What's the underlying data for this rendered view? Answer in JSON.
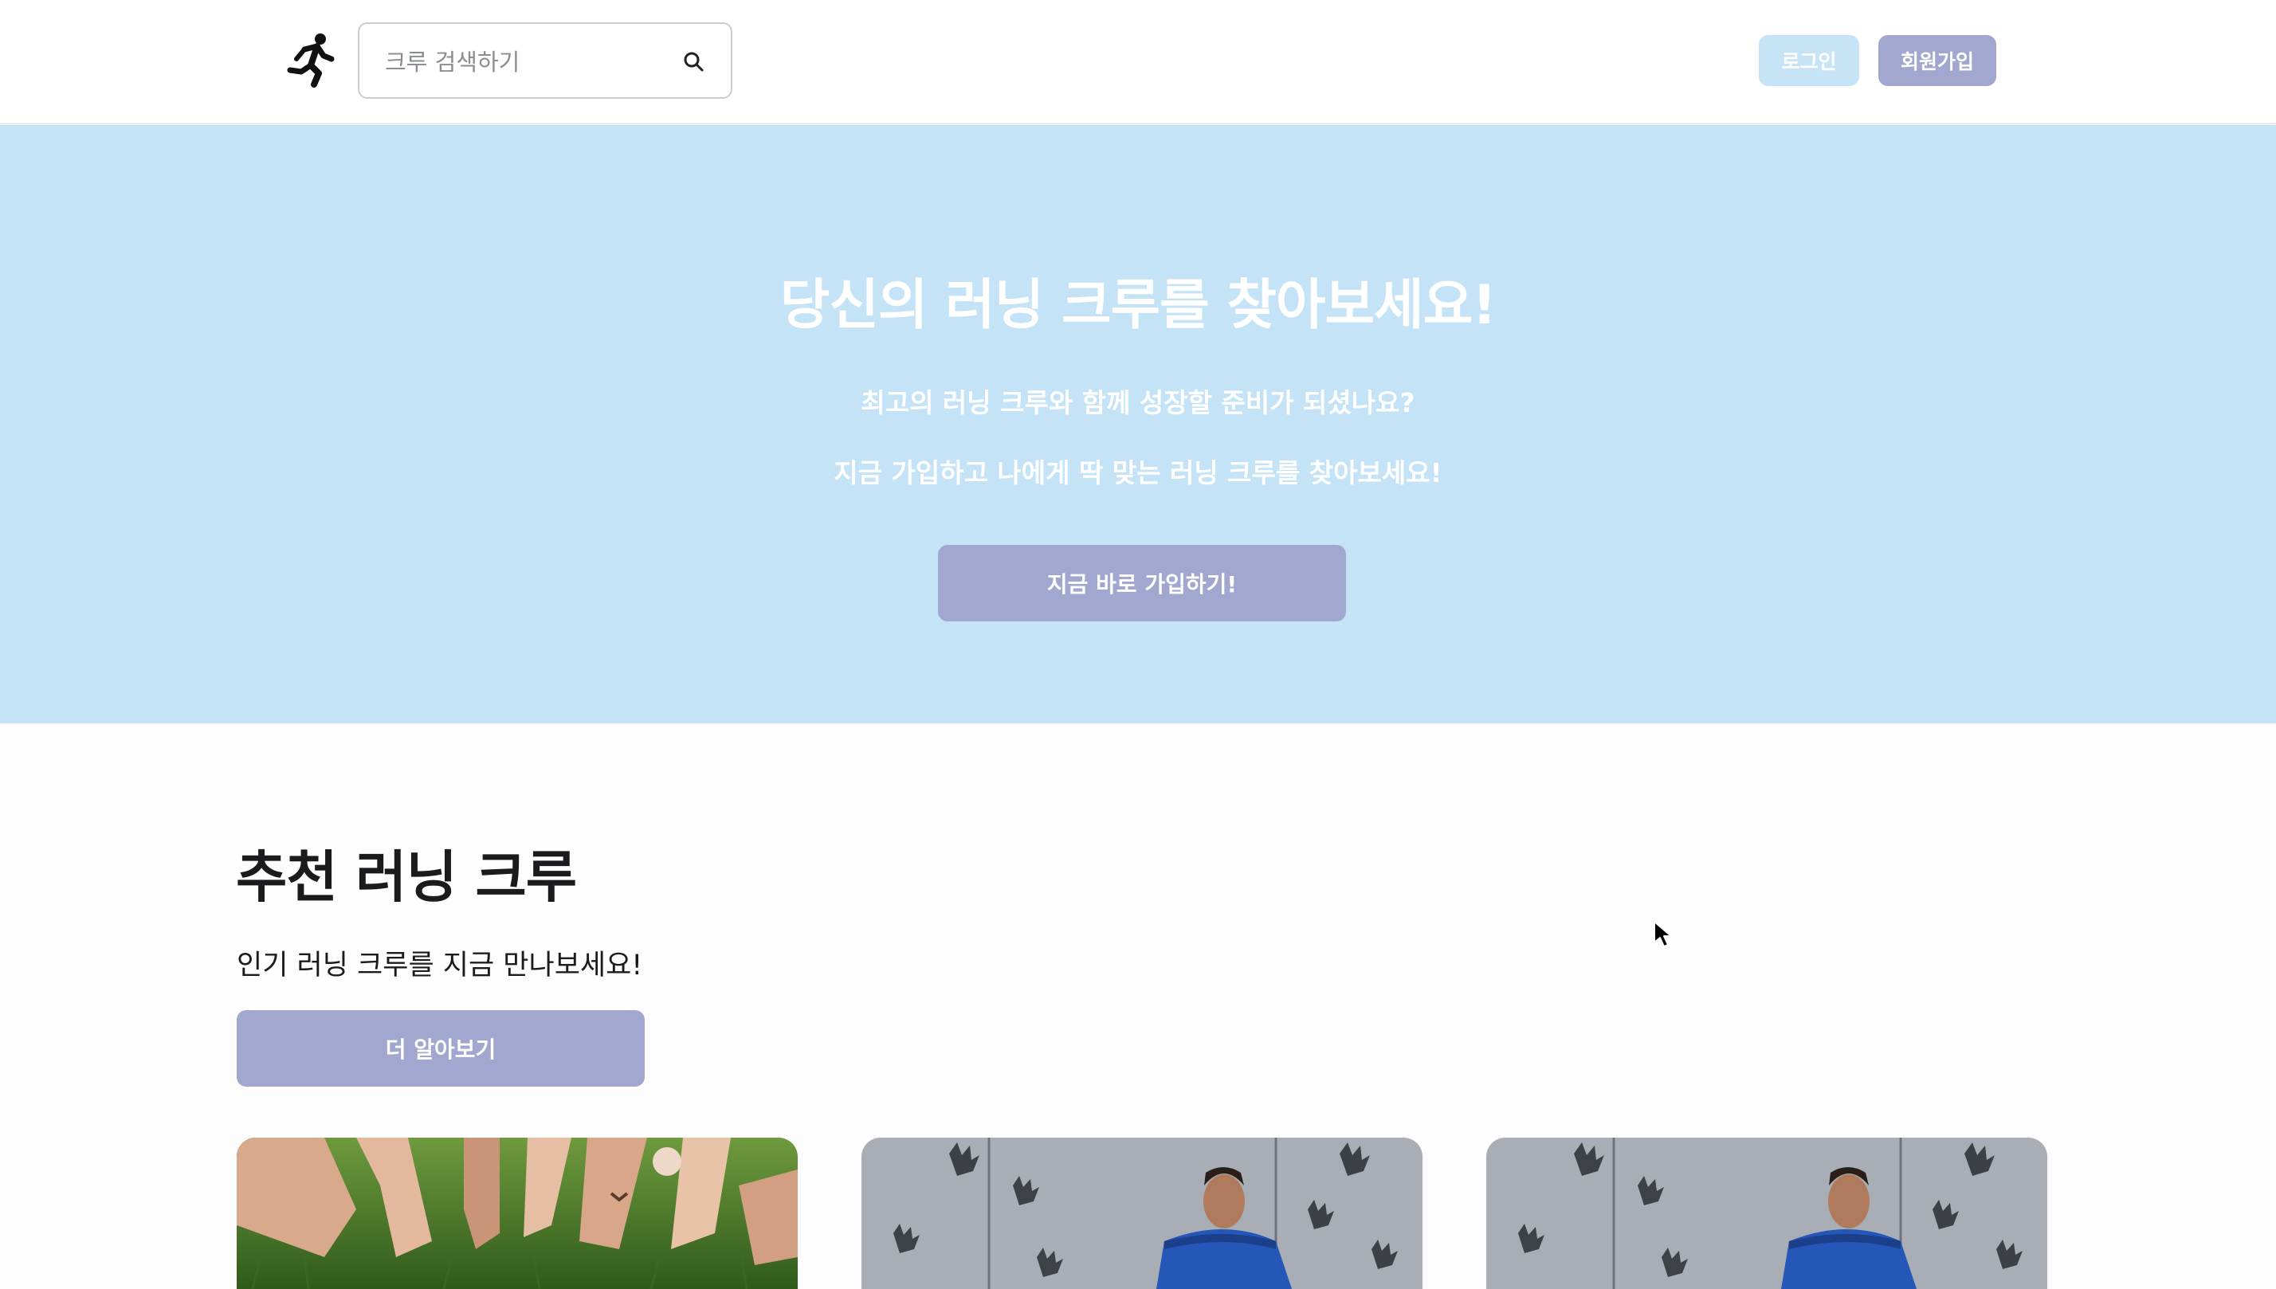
{
  "header": {
    "logo_icon": "runner-icon",
    "search": {
      "placeholder": "크루 검색하기",
      "value": "",
      "icon": "search-icon"
    },
    "login_label": "로그인",
    "signup_label": "회원가입"
  },
  "hero": {
    "title": "당신의 러닝 크루를 찾아보세요!",
    "subtitle_1": "최고의 러닝 크루와 함께 성장할 준비가 되셨나요?",
    "subtitle_2": "지금 가입하고 나에게 딱 맞는 러닝 크루를 찾아보세요!",
    "cta_label": "지금 바로 가입하기!"
  },
  "recommended": {
    "title": "추천 러닝 크루",
    "description": "인기 러닝 크루를 지금 만나보세요!",
    "more_label": "더 알아보기",
    "cards": [
      {
        "image": "hands-on-grass-photo"
      },
      {
        "image": "runner-handprint-wall-photo"
      },
      {
        "image": "runner-handprint-wall-photo"
      }
    ]
  },
  "colors": {
    "hero_bg": "#c5e3f6",
    "primary_button": "#a1a7cf",
    "login_button": "#c7e4f6",
    "text_dark": "#1b1b1d"
  }
}
